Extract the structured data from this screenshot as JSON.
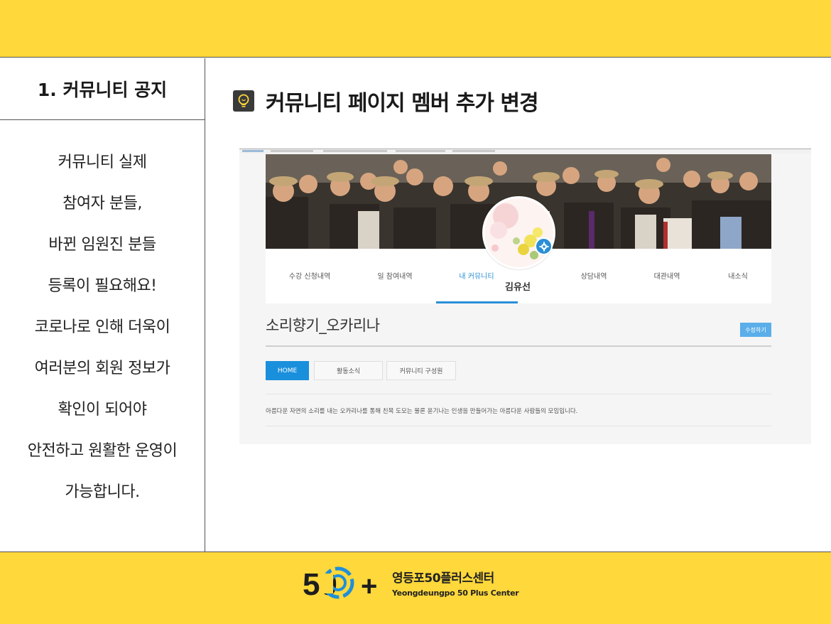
{
  "slide": {
    "sidebar_title": "1. 커뮤니티 공지",
    "sidebar_lines": [
      "커뮤니티 실제",
      "참여자 분들,",
      "바뀐 임원진 분들",
      "등록이 필요해요!",
      "코로나로 인해 더욱이",
      "여러분의 회원 정보가",
      "확인이 되어야",
      "안전하고 원활한 운영이",
      "가능합니다."
    ],
    "main_title": "커뮤니티 페이지 멤버 추가 변경"
  },
  "screenshot": {
    "nav_items": [
      "수강 신청내역",
      "일 참여내역",
      "내 커뮤니티",
      "상담내역",
      "대관내역",
      "내소식"
    ],
    "active_nav": "내 커뮤니티",
    "profile_name": "김유선",
    "community_name": "소리향기_오카리나",
    "edit_button": "수정하기",
    "tabs": [
      "HOME",
      "활동소식",
      "커뮤니티 구성원"
    ],
    "active_tab": "HOME",
    "intro_text": "아름다운 자연의 소리를 내는 오카리나를 통해 친목 도모는 물론 윤기나는 인생을 만들어가는 아름다운 사람들의 모임입니다."
  },
  "footer": {
    "logo_number": "50",
    "logo_plus": "+",
    "org_name_kr": "영등포50플러스센터",
    "org_name_en": "Yeongdeungpo 50 Plus Center"
  },
  "colors": {
    "band_yellow": "#ffd83b",
    "accent_blue": "#2a8fd6",
    "tab_active_blue": "#1a8fdc",
    "edit_button_blue": "#5aaee9",
    "logo_ring_blue": "#1f8fd8"
  },
  "icons": [
    "lightbulb-icon",
    "gear-icon",
    "logo-ring-icon"
  ]
}
